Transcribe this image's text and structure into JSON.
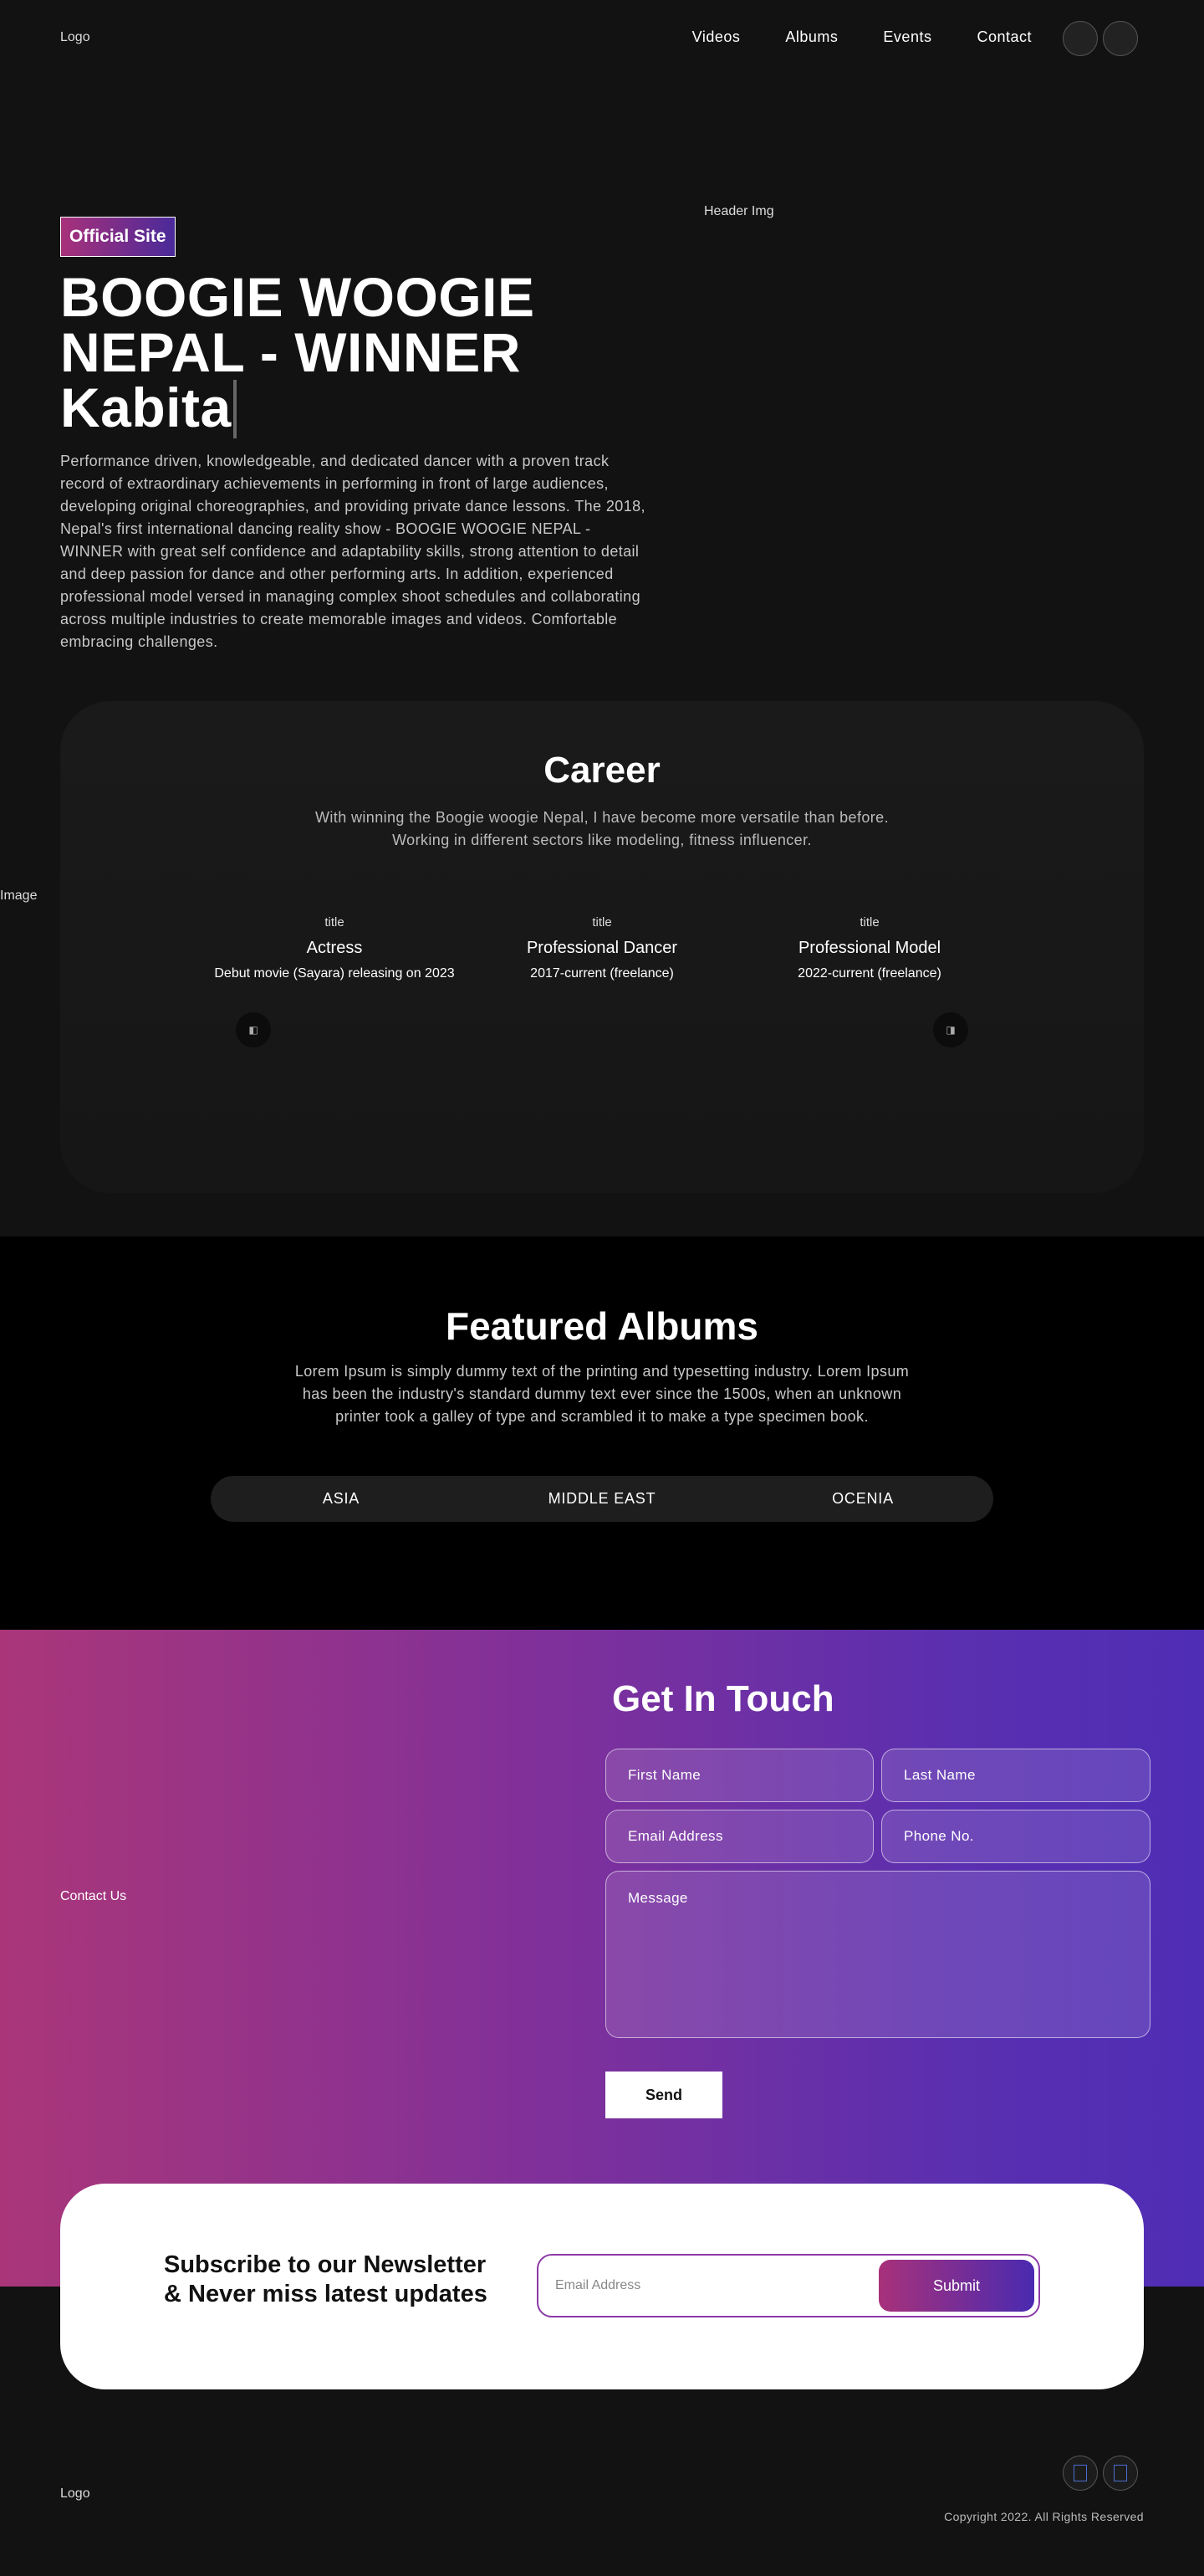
{
  "nav": {
    "logo_alt": "Logo",
    "links": [
      "Videos",
      "Albums",
      "Events",
      "Contact"
    ]
  },
  "hero": {
    "badge": "Official Site",
    "title_line1": "BOOGIE WOOGIE",
    "title_line2": "NEPAL - WINNER",
    "title_line3": "Kabita",
    "description": "Performance driven, knowledgeable, and dedicated dancer with a proven track record of extraordinary achievements in performing in front of large audiences, developing original choreographies, and providing private dance lessons. The 2018, Nepal's first international dancing reality show - BOOGIE WOOGIE NEPAL - WINNER with great self confidence and adaptability skills, strong attention to detail and deep passion for dance and other performing arts. In addition, experienced professional model versed in managing complex shoot schedules and collaborating across multiple industries to create memorable images and videos. Comfortable embracing challenges.",
    "header_img_alt": "Header Img"
  },
  "career": {
    "bg_img_alt": "Image",
    "title": "Career",
    "subtitle": "With winning the Boogie woogie Nepal, I have become more versatile than before. Working in different sectors like modeling, fitness influencer.",
    "items": [
      {
        "img_alt": "title",
        "title": "Actress",
        "detail": "Debut movie (Sayara) releasing on 2023"
      },
      {
        "img_alt": "title",
        "title": "Professional Dancer",
        "detail": "2017-current (freelance)"
      },
      {
        "img_alt": "title",
        "title": "Professional Model",
        "detail": "2022-current (freelance)"
      }
    ],
    "prev_icon": "◧",
    "next_icon": "◨"
  },
  "albums": {
    "title": "Featured Albums",
    "subtitle": "Lorem Ipsum is simply dummy text of the printing and typesetting industry. Lorem Ipsum has been the industry's standard dummy text ever since the 1500s, when an unknown printer took a galley of type and scrambled it to make a type specimen book.",
    "tabs": [
      "ASIA",
      "MIDDLE EAST",
      "OCENIA"
    ]
  },
  "contact": {
    "img_alt": "Contact Us",
    "title": "Get In Touch",
    "first_name": "First Name",
    "last_name": "Last Name",
    "email": "Email Address",
    "phone": "Phone No.",
    "message": "Message",
    "send": "Send"
  },
  "newsletter": {
    "title_line1": "Subscribe to our Newsletter",
    "title_line2": "& Never miss latest updates",
    "placeholder": "Email Address",
    "submit": "Submit"
  },
  "footer": {
    "logo_alt": "Logo",
    "copyright": "Copyright 2022. All Rights Reserved"
  },
  "colors": {
    "accent_start": "#aa3679",
    "accent_end": "#4f2db5",
    "background": "#121212"
  }
}
